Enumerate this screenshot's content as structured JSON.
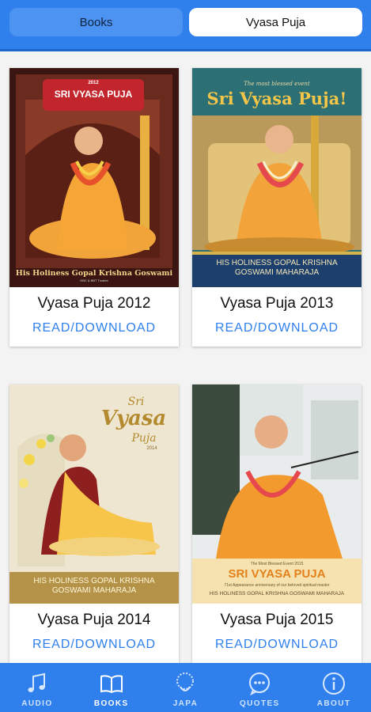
{
  "tabs": [
    {
      "label": "Books",
      "active": false
    },
    {
      "label": "Vyasa Puja",
      "active": true
    }
  ],
  "cards": [
    {
      "title": "Vyasa Puja 2012",
      "action": "READ/DOWNLOAD",
      "cover": {
        "year": "2012",
        "heading": "SRI VYASA PUJA",
        "name": "His Holiness Gopal Krishna Goswami",
        "sub": "GBC & BBT Trustee"
      }
    },
    {
      "title": "Vyasa Puja 2013",
      "action": "READ/DOWNLOAD",
      "cover": {
        "kicker": "The most blessed event",
        "heading": "Sri Vyasa Puja!",
        "name": "HIS HOLINESS GOPAL KRISHNA GOSWAMI MAHARAJA"
      }
    },
    {
      "title": "Vyasa Puja 2014",
      "action": "READ/DOWNLOAD",
      "cover": {
        "heading1": "Sri",
        "heading2": "Vyasa",
        "heading3": "Puja",
        "year": "2014",
        "name": "HIS HOLINESS GOPAL KRISHNA GOSWAMI MAHARAJA"
      }
    },
    {
      "title": "Vyasa Puja 2015",
      "action": "READ/DOWNLOAD",
      "cover": {
        "kicker": "The Most Blessed Event 2015",
        "heading": "SRI VYASA PUJA",
        "sub": "71st Appearance anniversary of our beloved spiritual master",
        "name": "HIS HOLINESS GOPAL KRISHNA GOSWAMI MAHARAJA"
      }
    }
  ],
  "nav": [
    {
      "label": "AUDIO",
      "icon": "music-note-icon",
      "active": false
    },
    {
      "label": "BOOKS",
      "icon": "open-book-icon",
      "active": true
    },
    {
      "label": "JAPA",
      "icon": "japa-beads-icon",
      "active": false
    },
    {
      "label": "QUOTES",
      "icon": "speech-bubble-icon",
      "active": false
    },
    {
      "label": "ABOUT",
      "icon": "info-icon",
      "active": false
    }
  ],
  "colors": {
    "primary": "#2f80ed",
    "link": "#2f80ed"
  }
}
